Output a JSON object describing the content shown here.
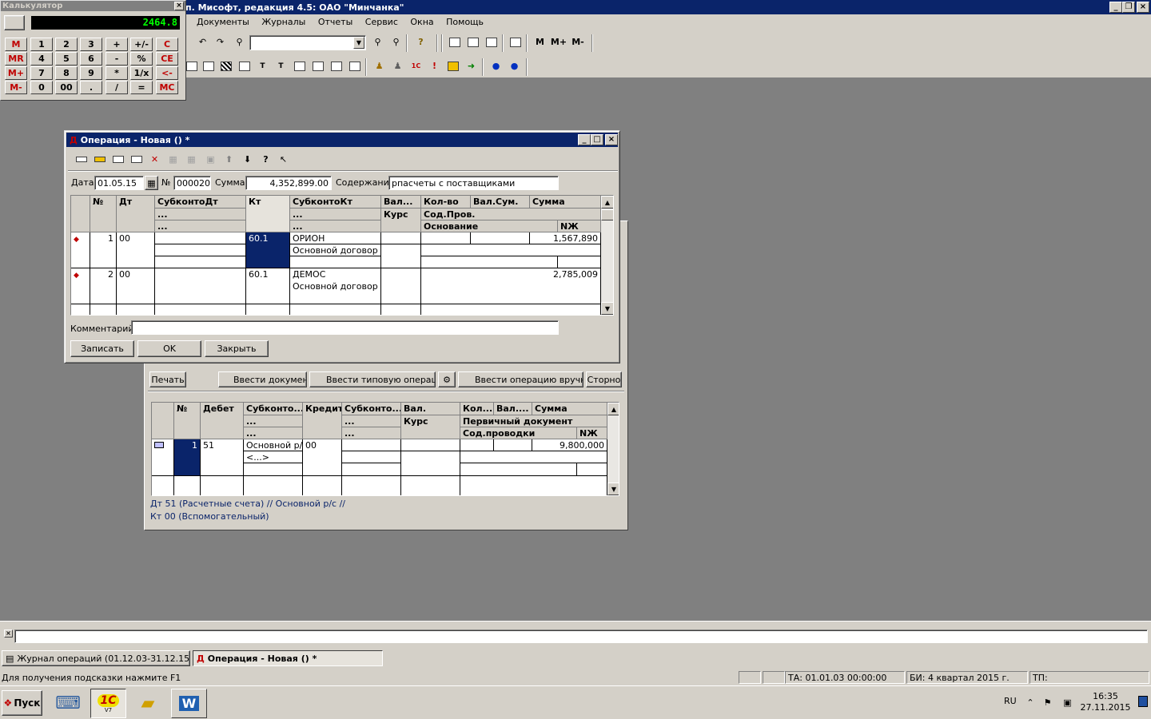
{
  "app": {
    "title": "п. Мисофт, редакция 4.5: ОАО \"Минчанка\"",
    "menu": [
      "Документы",
      "Журналы",
      "Отчеты",
      "Сервис",
      "Окна",
      "Помощь"
    ],
    "toolbar_text": {
      "m": "M",
      "mplus": "M+",
      "mminus": "M-"
    }
  },
  "calculator": {
    "title": "Калькулятор",
    "display": "2464.8",
    "rows": [
      [
        "M",
        "1",
        "2",
        "3",
        "+",
        "+/-",
        "C"
      ],
      [
        "MR",
        "4",
        "5",
        "6",
        "-",
        "%",
        "CE"
      ],
      [
        "M+",
        "7",
        "8",
        "9",
        "*",
        "1/x",
        "<-"
      ],
      [
        "M-",
        "0",
        "00",
        ".",
        "/",
        "=",
        "MC"
      ]
    ]
  },
  "operation": {
    "title": "Операция - Новая () *",
    "date_label": "Дата",
    "date": "01.05.15",
    "num_label": "№",
    "num": "000020",
    "sum_label": "Сумма",
    "sum": "4,352,899.00",
    "content_label": "Содержание",
    "content": "рпасчеты с поставщиками",
    "headers": {
      "num": "№",
      "dt": "Дт",
      "subdt": "СубконтоДт",
      "dots": "...",
      "kt": "Кт",
      "subkt": "СубконтоКт",
      "val": "Вал...",
      "kurs": "Курс",
      "kolvo": "Кол-во",
      "valsum": "Вал.Сум.",
      "summa": "Сумма",
      "sodprov": "Сод.Пров.",
      "osnov": "Основание",
      "nzh": "NЖ"
    },
    "rows": [
      {
        "num": "1",
        "dt": "00",
        "kt": "60.1",
        "subkt1": "ОРИОН",
        "subkt2": "Основной договор",
        "summa": "1,567,890"
      },
      {
        "num": "2",
        "dt": "00",
        "kt": "60.1",
        "subkt1": "ДЕМОС",
        "subkt2": "Основной договор",
        "summa": "2,785,009"
      }
    ],
    "comment_label": "Комментарий:",
    "comment": "",
    "buttons": {
      "save": "Записать",
      "ok": "OK",
      "close": "Закрыть"
    }
  },
  "journal": {
    "buttons": {
      "print": "Печать",
      "enter_doc": "Ввести документ",
      "enter_typical": "Ввести типовую операцию",
      "enter_manual": "Ввести операцию вручную",
      "storno": "Сторно"
    },
    "headers": {
      "num": "№",
      "debet": "Дебет",
      "subk1": "Субконто...",
      "dots": "...",
      "kredit": "Кредит",
      "subk2": "Субконто...",
      "val": "Вал.",
      "kurs": "Курс",
      "kol": "Кол...",
      "valx": "Вал....",
      "summa": "Сумма",
      "perv": "Первичный документ",
      "sodprov": "Сод.проводки",
      "nzh": "NЖ"
    },
    "row": {
      "num": "1",
      "debet": "51",
      "subk1": "Основной р/с",
      "subk1b": "<...>",
      "kredit": "00",
      "summa": "9,800,000"
    },
    "info1": "Дт 51 (Расчетные счета) // Основной р/с //",
    "info2": "Кт 00 (Вспомогательный)"
  },
  "tabs": [
    {
      "label": "Журнал операций  (01.12.03-31.12.15)"
    },
    {
      "label": "Операция - Новая () *"
    }
  ],
  "status": {
    "hint": "Для получения подсказки нажмите F1",
    "ta": "ТА: 01.01.03  00:00:00",
    "bi": "БИ: 4 квартал 2015 г.",
    "tp": "ТП:"
  },
  "taskbar": {
    "start": "Пуск",
    "lang": "RU",
    "time": "16:35",
    "date": "27.11.2015",
    "v7": "V7"
  },
  "colors": {
    "mdi_bg": "#808080",
    "title_active": "#0a246a",
    "face": "#d4d0c8",
    "calc_display": "#00ff00"
  }
}
